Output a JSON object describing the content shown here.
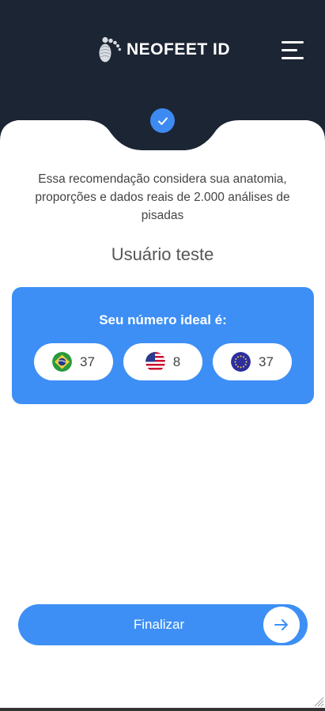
{
  "header": {
    "logo_text": "NEOFEET ID",
    "menu_icon": "hamburger-menu-icon"
  },
  "status": {
    "icon": "check-icon"
  },
  "intro_text": "Essa recomendação considera sua anatomia, proporções e dados reais de 2.000 análises de pisadas",
  "user": {
    "name": "Usuário teste"
  },
  "card": {
    "title": "Seu número ideal é:",
    "sizes": [
      {
        "flag": "brazil-flag-icon",
        "value": "37"
      },
      {
        "flag": "usa-flag-icon",
        "value": "8"
      },
      {
        "flag": "eu-flag-icon",
        "value": "37"
      }
    ]
  },
  "actions": {
    "finish_label": "Finalizar",
    "finish_icon": "arrow-right-icon"
  },
  "colors": {
    "header_bg": "#1c2533",
    "accent": "#3d8ff5",
    "background": "#ffffff"
  }
}
